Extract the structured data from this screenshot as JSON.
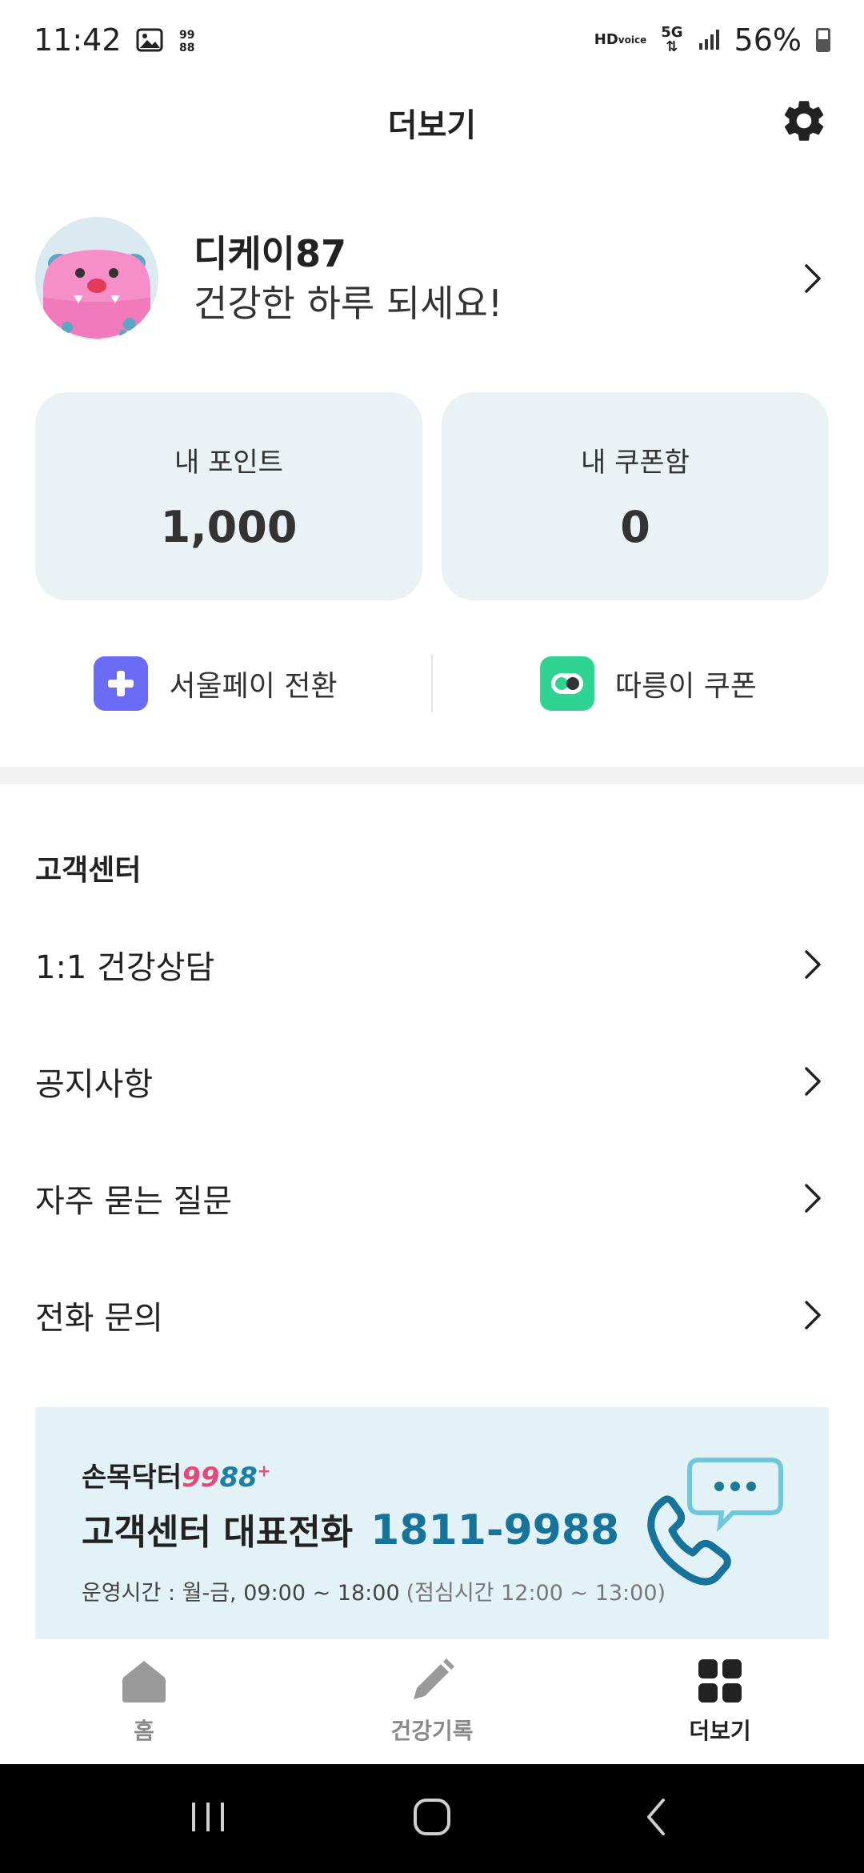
{
  "status_bar": {
    "time": "11:42",
    "battery": "56%",
    "icons": [
      "gallery-icon",
      "app-notification-icon",
      "hd-voice-icon",
      "5g-icon",
      "signal-icon",
      "battery-icon"
    ]
  },
  "header": {
    "title": "더보기",
    "settings_icon": "gear-icon"
  },
  "profile": {
    "name": "디케이87",
    "greeting": "건강한 하루 되세요!"
  },
  "cards": [
    {
      "label": "내 포인트",
      "value": "1,000"
    },
    {
      "label": "내 쿠폰함",
      "value": "0"
    }
  ],
  "quick_links": [
    {
      "label": "서울페이 전환",
      "icon": "seoulpay-icon",
      "color": "#6b6cf5"
    },
    {
      "label": "따릉이 쿠폰",
      "icon": "ddareungi-icon",
      "color": "#2fd493"
    }
  ],
  "customer_center": {
    "title": "고객센터",
    "items": [
      {
        "label": "1:1 건강상담"
      },
      {
        "label": "공지사항"
      },
      {
        "label": "자주 묻는 질문"
      },
      {
        "label": "전화 문의"
      }
    ]
  },
  "banner": {
    "logo_text": "손목닥터",
    "logo_num_a": "99",
    "logo_num_b": "88",
    "logo_plus": "+",
    "title": "고객센터 대표전화",
    "phone": "1811-9988",
    "hours": "운영시간 : 월-금, 09:00 ~ 18:00",
    "lunch": "(점심시간 12:00 ~ 13:00)"
  },
  "tab_bar": {
    "tabs": [
      {
        "label": "홈",
        "icon": "home-icon",
        "active": false
      },
      {
        "label": "건강기록",
        "icon": "pencil-icon",
        "active": false
      },
      {
        "label": "더보기",
        "icon": "grid-icon",
        "active": true
      }
    ]
  },
  "colors": {
    "card_bg": "#eaf2f5",
    "banner_bg": "#e2f2f6",
    "phone_accent": "#17739a",
    "inactive_tab": "#8a8a8a"
  }
}
